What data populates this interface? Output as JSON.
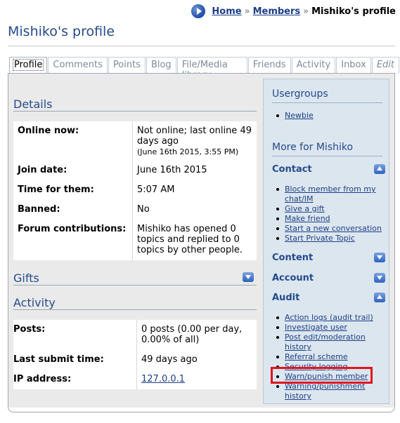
{
  "breadcrumb": {
    "home": "Home",
    "sep": "»",
    "members": "Members",
    "current": "Mishiko's profile"
  },
  "title": "Mishiko's profile",
  "tabs": [
    "Profile",
    "Comments",
    "Points",
    "Blog",
    "File/Media library",
    "Friends",
    "Activity",
    "Inbox",
    "Edit"
  ],
  "details": {
    "heading": "Details",
    "rows": [
      {
        "label": "Online now:",
        "value": "Not online; last online 49 days ago",
        "sub": "(June 16th 2015, 3:55 PM)"
      },
      {
        "label": "Join date:",
        "value": "June 16th 2015"
      },
      {
        "label": "Time for them:",
        "value": "5:07 AM"
      },
      {
        "label": "Banned:",
        "value": "No"
      },
      {
        "label": "Forum contributions:",
        "value": "Mishiko has opened 0 topics and replied to 0 topics by other people."
      }
    ]
  },
  "gifts": {
    "heading": "Gifts"
  },
  "activity": {
    "heading": "Activity",
    "rows": [
      {
        "label": "Posts:",
        "value": "0 posts (0.00 per day, 0.00% of all)"
      },
      {
        "label": "Last submit time:",
        "value": "49 days ago"
      },
      {
        "label": "IP address:",
        "value": "127.0.0.1"
      }
    ]
  },
  "sidebar": {
    "usergroups_heading": "Usergroups",
    "usergroups": [
      "Newbie"
    ],
    "more_heading": "More for Mishiko",
    "contact_heading": "Contact",
    "contact_links": [
      "Block member from my chat/IM",
      "Give a gift",
      "Make friend",
      "Start a new conversation",
      "Start Private Topic"
    ],
    "content_heading": "Content",
    "account_heading": "Account",
    "audit_heading": "Audit",
    "audit_links": [
      "Action logs (audit trail)",
      "Investigate user",
      "Post edit/moderation history",
      "Referral scheme",
      "Security logging",
      "Warn/punish member",
      "Warning/punishment history"
    ]
  },
  "colors": {
    "heading": "#254a8b",
    "link": "#1d3f86",
    "highlight": "#e0141e",
    "panel": "#eaeaea",
    "sidebar": "#dce6ef"
  }
}
